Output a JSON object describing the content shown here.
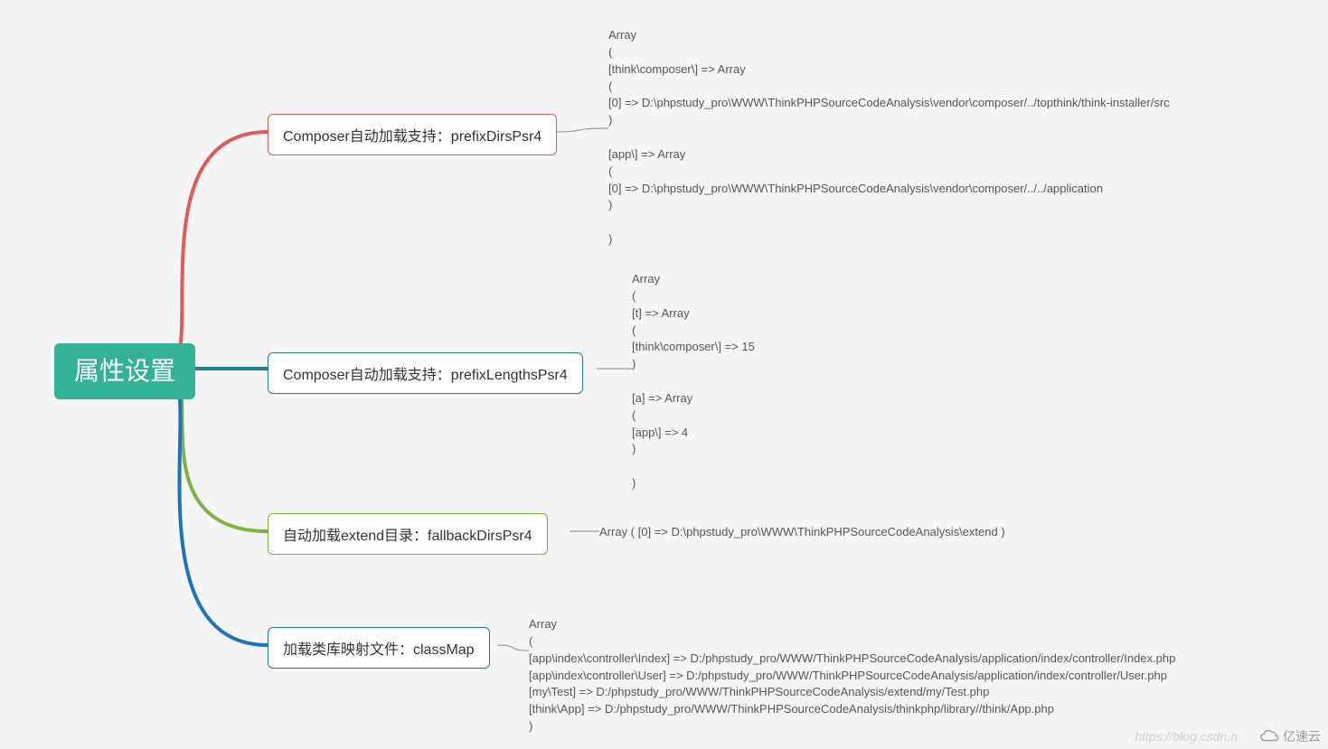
{
  "root": "属性设置",
  "nodes": {
    "n1": "Composer自动加载支持：prefixDirsPsr4",
    "n2": "Composer自动加载支持：prefixLengthsPsr4",
    "n3": "自动加载extend目录：fallbackDirsPsr4",
    "n4": "加载类库映射文件：classMap"
  },
  "leaves": {
    "l1": "Array\n(\n[think\\composer\\] => Array\n(\n[0] => D:\\phpstudy_pro\\WWW\\ThinkPHPSourceCodeAnalysis\\vendor\\composer/../topthink/think-installer/src\n)\n\n[app\\] => Array\n(\n[0] => D:\\phpstudy_pro\\WWW\\ThinkPHPSourceCodeAnalysis\\vendor\\composer/../../application\n)\n\n)",
    "l2": "Array\n(\n[t] => Array\n(\n[think\\composer\\] => 15\n)\n\n[a] => Array\n(\n[app\\] => 4\n)\n\n)",
    "l3": "Array ( [0] => D:\\phpstudy_pro\\WWW\\ThinkPHPSourceCodeAnalysis\\extend )",
    "l4": "Array\n(\n[app\\index\\controller\\Index] => D:/phpstudy_pro/WWW/ThinkPHPSourceCodeAnalysis/application/index/controller/Index.php\n[app\\index\\controller\\User] => D:/phpstudy_pro/WWW/ThinkPHPSourceCodeAnalysis/application/index/controller/User.php\n[my\\Test] => D:/phpstudy_pro/WWW/ThinkPHPSourceCodeAnalysis/extend/my/Test.php\n[think\\App] => D:/phpstudy_pro/WWW/ThinkPHPSourceCodeAnalysis/thinkphp/library//think/App.php\n)"
  },
  "watermark": "亿速云",
  "watermark2": "https://blog.csdn.n",
  "chart_data": {
    "type": "mindmap",
    "root": "属性设置",
    "children": [
      {
        "label": "Composer自动加载支持：prefixDirsPsr4",
        "color": "#e05a57",
        "value": "Array ( [think\\composer\\] => Array ( [0] => D:\\phpstudy_pro\\WWW\\ThinkPHPSourceCodeAnalysis\\vendor\\composer/../topthink/think-installer/src ) [app\\] => Array ( [0] => D:\\phpstudy_pro\\WWW\\ThinkPHPSourceCodeAnalysis\\vendor\\composer/../../application ) )"
      },
      {
        "label": "Composer自动加载支持：prefixLengthsPsr4",
        "color": "#22808d",
        "value": "Array ( [t] => Array ( [think\\composer\\] => 15 ) [a] => Array ( [app\\] => 4 ) )"
      },
      {
        "label": "自动加载extend目录：fallbackDirsPsr4",
        "color": "#7cb342",
        "value": "Array ( [0] => D:\\phpstudy_pro\\WWW\\ThinkPHPSourceCodeAnalysis\\extend )"
      },
      {
        "label": "加载类库映射文件：classMap",
        "color": "#1e73be",
        "value": "Array ( [app\\index\\controller\\Index] => D:/phpstudy_pro/WWW/ThinkPHPSourceCodeAnalysis/application/index/controller/Index.php [app\\index\\controller\\User] => D:/phpstudy_pro/WWW/ThinkPHPSourceCodeAnalysis/application/index/controller/User.php [my\\Test] => D:/phpstudy_pro/WWW/ThinkPHPSourceCodeAnalysis/extend/my/Test.php [think\\App] => D:/phpstudy_pro/WWW/ThinkPHPSourceCodeAnalysis/thinkphp/library//think/App.php )"
      }
    ]
  }
}
